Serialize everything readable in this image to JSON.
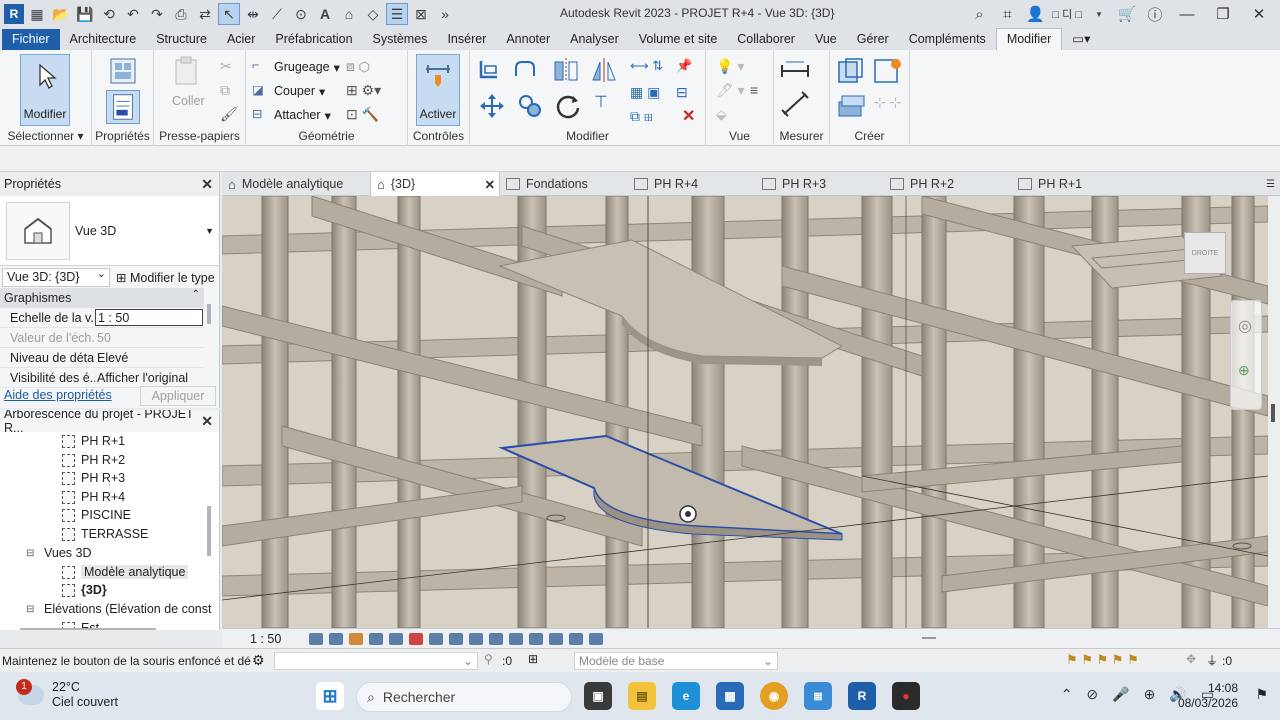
{
  "window": {
    "title": "Autodesk Revit 2023 - PROJET R+4 - Vue 3D: {3D}",
    "user": "□ 디 □",
    "app_logo": "R"
  },
  "ribbon_tabs": [
    "Fichier",
    "Architecture",
    "Structure",
    "Acier",
    "Préfabrication",
    "Systèmes",
    "Insérer",
    "Annoter",
    "Analyser",
    "Volume et site",
    "Collaborer",
    "Vue",
    "Gérer",
    "Compléments",
    "Modifier"
  ],
  "ribbon": {
    "modifier_btn": "Modifier",
    "selectionner": "Sélectionner",
    "proprietes": "Propriétés",
    "coller": "Coller",
    "presse_papiers": "Presse-papiers",
    "grugeage": "Grugeage",
    "couper": "Couper",
    "attacher": "Attacher",
    "geometrie": "Géométrie",
    "activer": "Activer",
    "controles": "Contrôles",
    "modifier_group": "Modifier",
    "vue": "Vue",
    "mesurer": "Mesurer",
    "creer": "Créer"
  },
  "properties": {
    "header": "Propriétés",
    "type_name": "Vue 3D",
    "view_select": "Vue 3D: {3D}",
    "edit_type": "Modifier le type",
    "category": "Graphismes",
    "rows": [
      {
        "name": "Echelle de la v...",
        "value": "1 : 50"
      },
      {
        "name": "Valeur de l'éch...",
        "value": "50"
      },
      {
        "name": "Niveau de détail",
        "value": "Elevé"
      },
      {
        "name": "Visibilité des é...",
        "value": "Afficher l'original"
      }
    ],
    "help_link": "Aide des propriétés",
    "apply": "Appliquer"
  },
  "browser": {
    "header": "Arborescence du projet - PROJET R...",
    "items": [
      "PH R+1",
      "PH R+2",
      "PH R+3",
      "PH R+4",
      "PISCINE",
      "TERRASSE"
    ],
    "group_3d": "Vues 3D",
    "views_3d": [
      "Modèle analytique",
      "{3D}"
    ],
    "elevations": "Elévations (Elévation de const",
    "elev_item": "Est"
  },
  "view_tabs": [
    "Modèle analytique",
    "{3D}",
    "Fondations",
    "PH R+4",
    "PH R+3",
    "PH R+2",
    "PH R+1"
  ],
  "viewcube_label": "DROITE",
  "view_control": {
    "scale": "1 : 50"
  },
  "status": {
    "message": "Maintenez le bouton de la souris enfoncé et dé",
    "filter_count": ":0",
    "model": "Modèle de base",
    "sel_count": ":0"
  },
  "taskbar": {
    "temperature": "22°C",
    "weather": "Ciel couvert",
    "weather_badge": "1",
    "search": "Rechercher",
    "time": "14:08",
    "date": "08/03/2026"
  },
  "colors": {
    "accent": "#1f5ea8",
    "selection": "#2a4fa8",
    "concrete": "#b9b1a3"
  }
}
